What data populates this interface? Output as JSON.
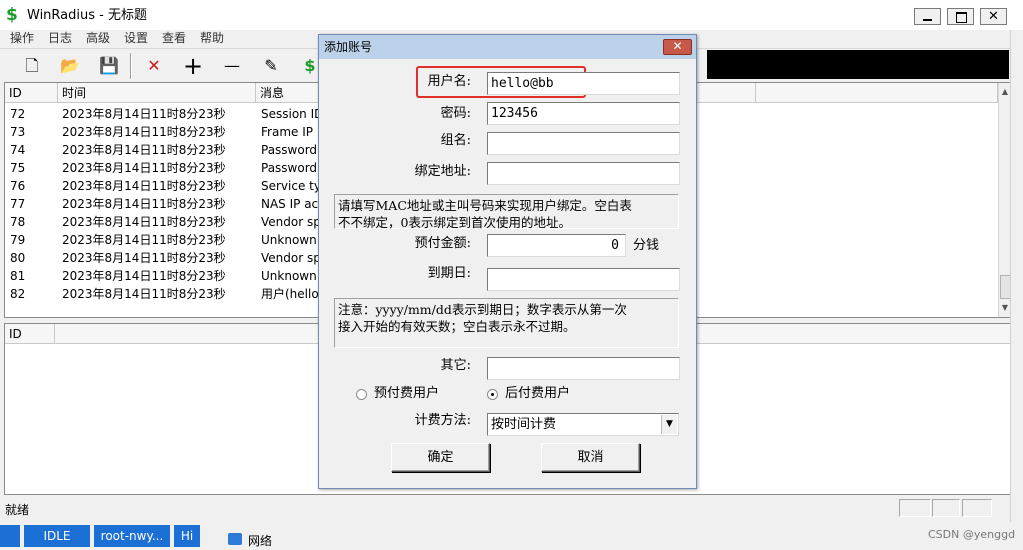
{
  "window": {
    "title": "WinRadius - 无标题",
    "close_glyph": "✕"
  },
  "menu": [
    "操作",
    "日志",
    "高级",
    "设置",
    "查看",
    "帮助"
  ],
  "toolbar": [
    {
      "icon": "new-file-icon",
      "glyph": "🗋"
    },
    {
      "icon": "open-folder-icon",
      "glyph": "📂"
    },
    {
      "icon": "save-icon",
      "glyph": "💾"
    },
    {
      "icon": "delete-icon",
      "glyph": "✕",
      "color": "#d01818"
    },
    {
      "icon": "add-icon",
      "glyph": "+"
    },
    {
      "icon": "remove-icon",
      "glyph": "—"
    },
    {
      "icon": "edit-icon",
      "glyph": "✎"
    },
    {
      "icon": "dollar-icon",
      "glyph": "$",
      "color": "#1f9a2a"
    }
  ],
  "log_table": {
    "headers": [
      "ID",
      "时间",
      "消息"
    ],
    "rows": [
      {
        "id": "72",
        "time": "2023年8月14日11时8分23秒",
        "msg": "Session ID"
      },
      {
        "id": "73",
        "time": "2023年8月14日11时8分23秒",
        "msg": "Frame IP"
      },
      {
        "id": "74",
        "time": "2023年8月14日11时8分23秒",
        "msg": "Password"
      },
      {
        "id": "75",
        "time": "2023年8月14日11时8分23秒",
        "msg": "Password"
      },
      {
        "id": "76",
        "time": "2023年8月14日11时8分23秒",
        "msg": "Service ty"
      },
      {
        "id": "77",
        "time": "2023年8月14日11时8分23秒",
        "msg": "NAS IP ac"
      },
      {
        "id": "78",
        "time": "2023年8月14日11时8分23秒",
        "msg": "Vendor sp"
      },
      {
        "id": "79",
        "time": "2023年8月14日11时8分23秒",
        "msg": "Unknown"
      },
      {
        "id": "80",
        "time": "2023年8月14日11时8分23秒",
        "msg": "Vendor sp"
      },
      {
        "id": "81",
        "time": "2023年8月14日11时8分23秒",
        "msg": "Unknown"
      },
      {
        "id": "82",
        "time": "2023年8月14日11时8分23秒",
        "msg": "用户(hello"
      }
    ]
  },
  "lower_table": {
    "headers": [
      "ID"
    ]
  },
  "status": {
    "text": "就绪"
  },
  "dialog": {
    "title": "添加账号",
    "close_glyph": "✕",
    "username_label": "用户名:",
    "username_value": "hello@bb",
    "password_label": "密码:",
    "password_value": "123456",
    "group_label": "组名:",
    "group_value": "",
    "bind_label": "绑定地址:",
    "bind_value": "",
    "bind_note_line1": "请填写MAC地址或主叫号码来实现用户绑定。空白表",
    "bind_note_line2": "不不绑定，0表示绑定到首次使用的地址。",
    "prepay_label": "预付金额:",
    "prepay_value": "0",
    "prepay_unit": "分钱",
    "expire_label": "到期日:",
    "expire_value": "",
    "expire_note_line1": "注意：yyyy/mm/dd表示到期日；数字表示从第一次",
    "expire_note_line2": "接入开始的有效天数；空白表示永不过期。",
    "other_label": "其它:",
    "other_value": "",
    "radio_prepaid": "预付费用户",
    "radio_postpaid": "后付费用户",
    "billing_label": "计费方法:",
    "billing_value": "按时间计费",
    "ok_button": "确定",
    "cancel_button": "取消"
  },
  "taskbar": {
    "items": [
      "IDLE",
      "root-nwy...",
      "Hi"
    ],
    "network_label": "网络"
  },
  "watermark": "CSDN @yenggd",
  "colors": {
    "highlight": "#e0302a",
    "dialog_title_bg": "#bcd2ea",
    "taskbar_item": "#1c6fd4"
  }
}
